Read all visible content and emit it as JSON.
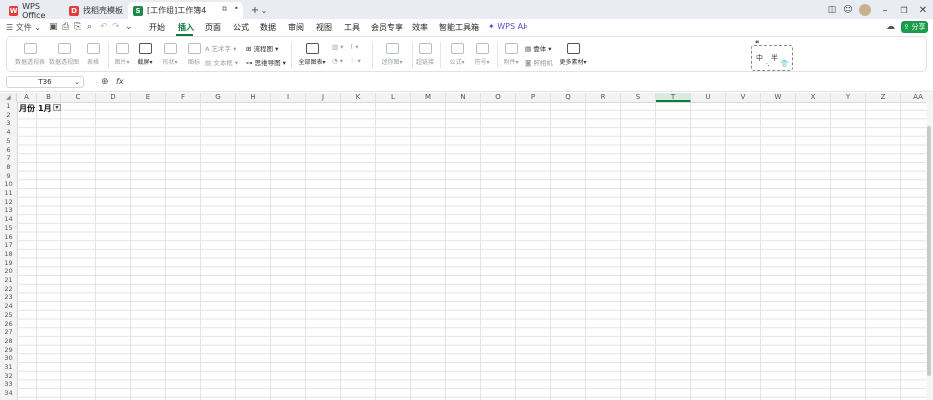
{
  "tabs": [
    {
      "label": "WPS Office",
      "logo": "W",
      "color": "#e23c3c"
    },
    {
      "label": "找稻壳模板",
      "logo": "D",
      "color": "#e23c3c"
    },
    {
      "label": "[工作组]工作簿4",
      "logo": "S",
      "color": "#1d8a47"
    }
  ],
  "menu": {
    "file": "文件",
    "items": [
      "开始",
      "插入",
      "页面",
      "公式",
      "数据",
      "审阅",
      "视图",
      "工具",
      "会员专享",
      "效率",
      "智能工具箱"
    ],
    "active": "插入",
    "wps_ai": "WPS AI",
    "share": "分享"
  },
  "ribbon": {
    "pivot_table": "数据透视表",
    "pivot_chart": "数据透视图",
    "table": "表格",
    "image": "图片",
    "screenshot": "截屏",
    "shape": "形状",
    "icon": "图标",
    "art_text": "艺术字",
    "text_box": "文本框",
    "flowchart": "流程图",
    "mind_map": "思维导图",
    "all_charts": "全部图表",
    "sparkline": "迷你图",
    "hyperlink": "超链接",
    "formula": "公式",
    "symbol": "符号",
    "attachment": "附件",
    "camera": "照相机",
    "body_text": "壹体",
    "more_material": "更多素材",
    "ime_cn": "中",
    "ime_half": "半"
  },
  "formula_bar": {
    "name_box": "T36",
    "fx": "fx"
  },
  "columns": [
    "A",
    "B",
    "C",
    "D",
    "E",
    "F",
    "G",
    "H",
    "I",
    "J",
    "K",
    "L",
    "M",
    "N",
    "O",
    "P",
    "Q",
    "R",
    "S",
    "T",
    "U",
    "V",
    "W",
    "X",
    "Y",
    "Z",
    "AA"
  ],
  "selected_column": "T",
  "rows": [
    "1",
    "2",
    "3",
    "4",
    "5",
    "6",
    "7",
    "8",
    "9",
    "10",
    "11",
    "12",
    "13",
    "14",
    "15",
    "16",
    "17",
    "18",
    "19",
    "20",
    "21",
    "22",
    "23",
    "24",
    "25",
    "26",
    "27",
    "28",
    "29",
    "30",
    "31",
    "32",
    "33",
    "34"
  ],
  "cells": {
    "A1": "月份",
    "B1": "1月"
  }
}
